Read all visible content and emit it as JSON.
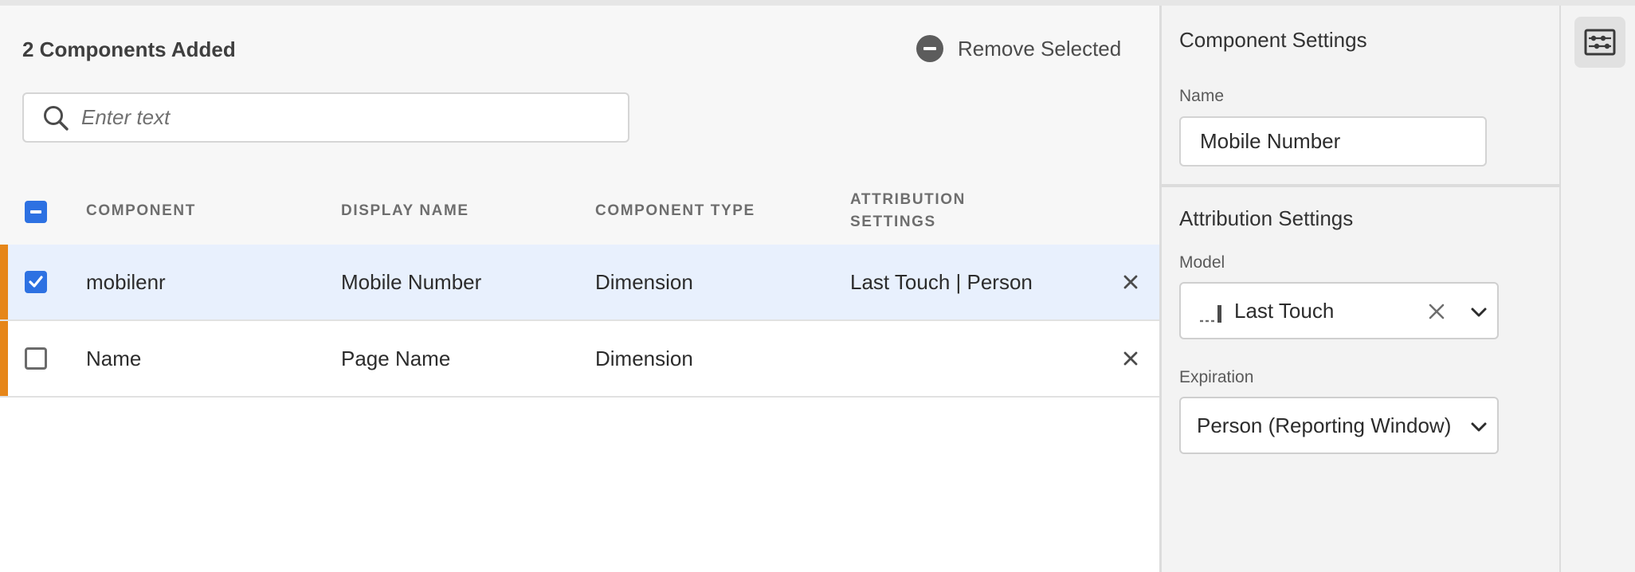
{
  "header": {
    "count_label": "2 Components Added",
    "remove_label": "Remove Selected"
  },
  "search": {
    "placeholder": "Enter text"
  },
  "columns": {
    "component": "COMPONENT",
    "display_name": "DISPLAY NAME",
    "component_type": "COMPONENT TYPE",
    "attribution_line1": "ATTRIBUTION",
    "attribution_line2": "SETTINGS"
  },
  "rows": [
    {
      "selected": true,
      "component": "mobilenr",
      "display_name": "Mobile Number",
      "component_type": "Dimension",
      "attribution": "Last Touch | Person"
    },
    {
      "selected": false,
      "component": "Name",
      "display_name": "Page Name",
      "component_type": "Dimension",
      "attribution": ""
    }
  ],
  "settings": {
    "component_title": "Component Settings",
    "name_label": "Name",
    "name_value": "Mobile Number",
    "attribution_title": "Attribution Settings",
    "model_label": "Model",
    "model_value": "Last Touch",
    "expiration_label": "Expiration",
    "expiration_value": "Person (Reporting Window)"
  },
  "icons": {
    "search": "search-icon",
    "remove": "minus-circle-icon",
    "row_remove": "close-icon",
    "model": "last-touch-model-icon",
    "clear": "clear-icon",
    "dropdown": "chevron-down-icon",
    "rail": "settings-panel-icon"
  },
  "colors": {
    "accent_blue": "#2d71e2",
    "row_marker_orange": "#e68619",
    "selected_row_bg": "#e8f0fd"
  }
}
